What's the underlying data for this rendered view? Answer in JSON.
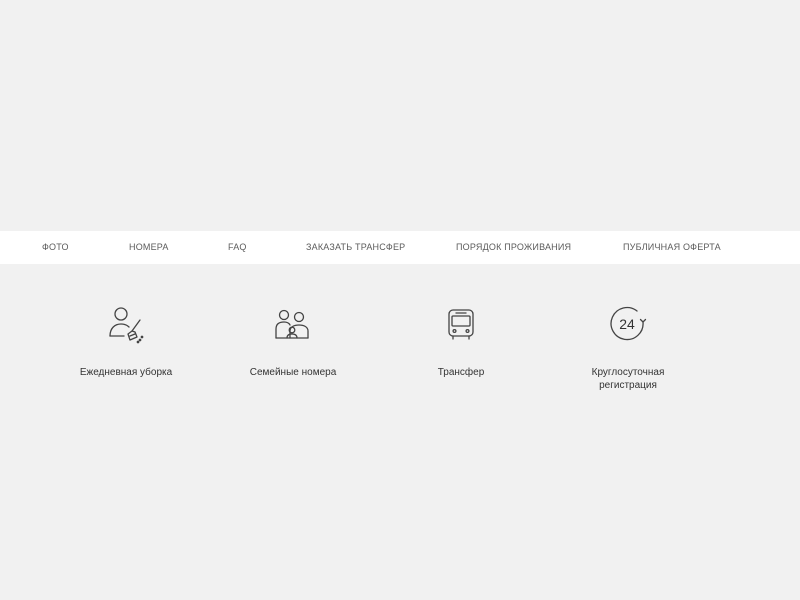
{
  "nav": {
    "items": [
      {
        "label": "ФОТО"
      },
      {
        "label": "НОМЕРА"
      },
      {
        "label": "FAQ"
      },
      {
        "label": "ЗАКАЗАТЬ ТРАНСФЕР"
      },
      {
        "label": "ПОРЯДОК ПРОЖИВАНИЯ"
      },
      {
        "label": "ПУБЛИЧНАЯ ОФЕРТА"
      }
    ]
  },
  "features": [
    {
      "label": "Ежедневная уборка",
      "icon": "cleaning-person-icon"
    },
    {
      "label": "Семейные номера",
      "icon": "family-icon"
    },
    {
      "label": "Трансфер",
      "icon": "bus-icon"
    },
    {
      "label": "Круглосуточная регистрация",
      "icon": "clock-24-icon",
      "badge": "24"
    }
  ],
  "colors": {
    "background": "#f1f1f1",
    "navbar": "#ffffff",
    "nav_text": "#5b5b5b",
    "icon_stroke": "#444444"
  }
}
